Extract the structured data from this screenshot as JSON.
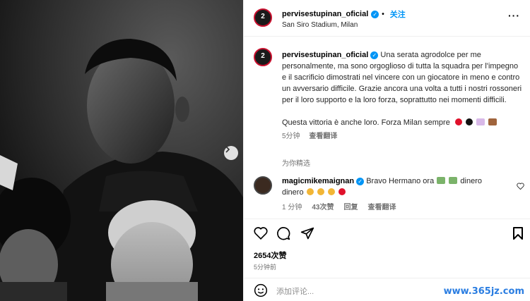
{
  "post": {
    "username": "pervisestupinan_oficial",
    "avatar_number": "2",
    "follow_label": "关注",
    "location": "San Siro Stadium, Milan",
    "more_label": "···"
  },
  "caption": {
    "username": "pervisestupinan_oficial",
    "text": "Una serata agrodolce per me personalmente, ma sono orgoglioso di tutta la squadra per l'impegno e il sacrificio dimostrati nel vincere con un giocatore in meno e contro un avversario difficile. Grazie ancora una volta a tutti i nostri rossoneri per il loro supporto e la loro forza, soprattutto nei momenti difficili.",
    "text2": "Questa vittoria è anche loro. Forza Milan sempre",
    "time": "5分钟",
    "translate": "查看翻译"
  },
  "selected_label": "为你精选",
  "comment": {
    "username": "magicmikemaignan",
    "text1": "Bravo Hermano ora",
    "text2": "dinero",
    "text3": "dinero",
    "time": "1 分钟",
    "likes": "43次赞",
    "reply": "回复",
    "translate": "查看翻译"
  },
  "likes_count": "2654次赞",
  "post_time": "5分钟前",
  "add_comment_placeholder": "添加评论...",
  "watermark": "www.365jz.com",
  "colors": {
    "accent": "#0095f6",
    "milan_red": "#c8102e"
  }
}
